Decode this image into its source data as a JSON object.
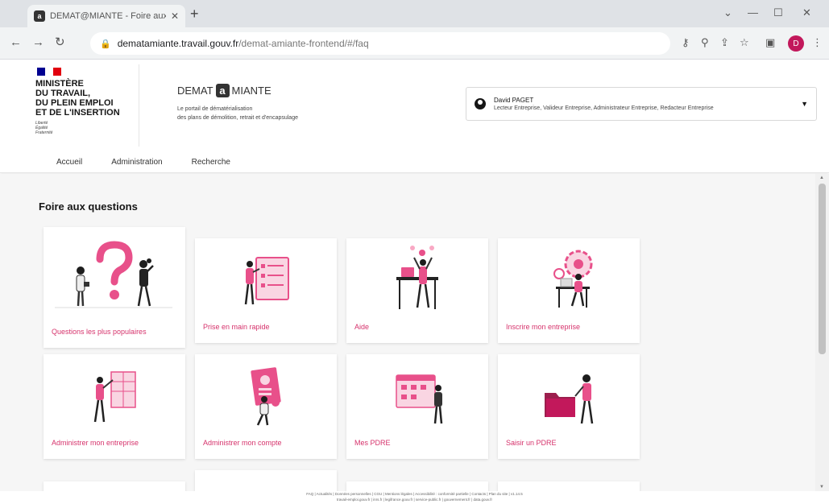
{
  "browser": {
    "tab_title": "DEMAT@MIANTE - Foire aux q...",
    "tab_favicon": "a",
    "url_host": "dematamiante.travail.gouv.fr",
    "url_path": "/demat-amiante-frontend/#/faq",
    "profile_initial": "D"
  },
  "header": {
    "ministry_lines": [
      "MINISTÈRE",
      "DU TRAVAIL,",
      "DU PLEIN EMPLOI",
      "ET DE L'INSERTION"
    ],
    "devise_lines": [
      "Liberté",
      "Égalité",
      "Fraternité"
    ],
    "brand_left": "DEMAT",
    "brand_logo": "a",
    "brand_right": "MIANTE",
    "tagline_1": "Le portail de dématérialisation",
    "tagline_2": "des plans de démolition, retrait et d'encapsulage",
    "user_name": "David PAGET",
    "user_roles": "Lecteur Entreprise, Valideur Entreprise, Administrateur Entreprise, Redacteur Entreprise"
  },
  "nav": {
    "items": [
      {
        "label": "Accueil"
      },
      {
        "label": "Administration"
      },
      {
        "label": "Recherche"
      }
    ]
  },
  "main": {
    "title": "Foire aux questions",
    "cards": [
      {
        "label": "Questions les plus populaires",
        "icon": "question-people-illustration"
      },
      {
        "label": "Prise en main rapide",
        "icon": "checklist-board-illustration"
      },
      {
        "label": "Aide",
        "icon": "helper-desk-illustration"
      },
      {
        "label": "Inscrire mon entreprise",
        "icon": "gear-desk-illustration"
      },
      {
        "label": "Administrer mon entreprise",
        "icon": "wall-board-illustration"
      },
      {
        "label": "Administrer mon compte",
        "icon": "profile-card-illustration"
      },
      {
        "label": "Mes PDRE",
        "icon": "calendar-board-illustration"
      },
      {
        "label": "Saisir un PDRE",
        "icon": "folder-person-illustration"
      }
    ]
  },
  "footer": {
    "line1": "FAQ | Actualités | Données personnelles | CGU | Mentions légales | Accessibilité : conformité partielle | Contacts | Plan du site | v1.14.5",
    "line2": "travail-emploi.gouv.fr | inrs.fr | legifrance.gouv.fr | service-public.fr | gouvernement.fr | data.gouv.fr"
  },
  "colors": {
    "accent": "#d6336c",
    "illustration_pink": "#e8508a",
    "illustration_light": "#f9d5e2",
    "dark": "#161616",
    "page_bg": "#f6f6f6",
    "marianne_blue": "#000091",
    "marianne_red": "#e1000f"
  }
}
